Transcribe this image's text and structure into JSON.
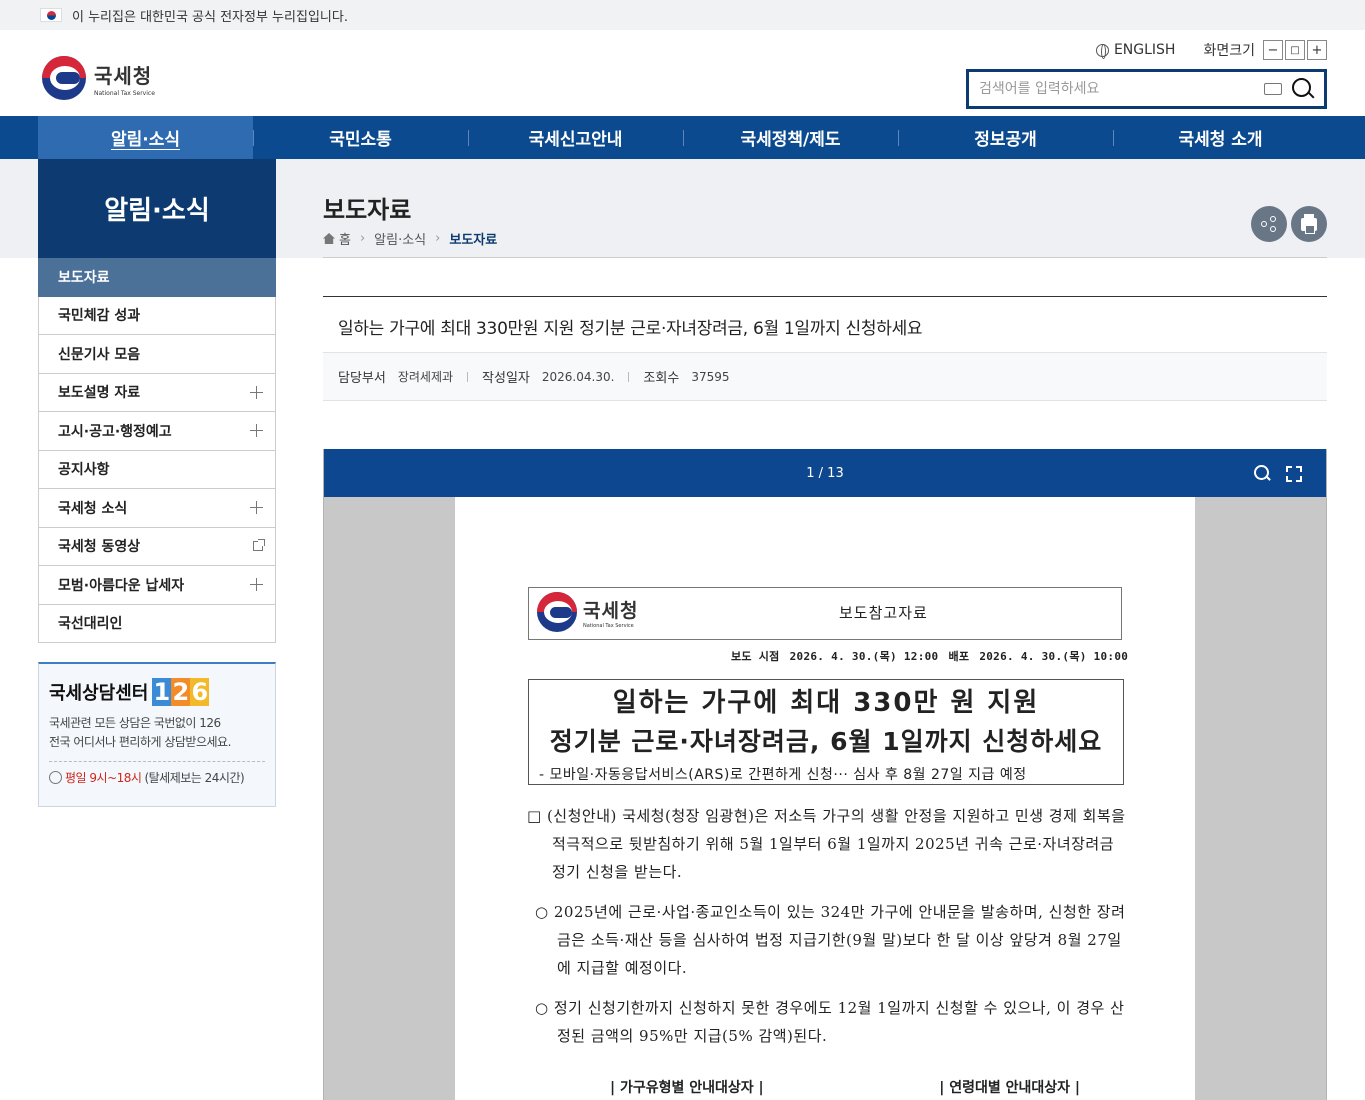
{
  "gov_banner": "이 누리집은 대한민국 공식 전자정부 누리집입니다.",
  "logo": {
    "ko": "국세청",
    "en": "National Tax Service"
  },
  "util": {
    "english": "ENGLISH",
    "font_size_label": "화면크기",
    "minus": "−",
    "reset": "□",
    "plus": "+"
  },
  "search": {
    "placeholder": "검색어를 입력하세요"
  },
  "gnb": [
    "알림·소식",
    "국민소통",
    "국세신고안내",
    "국세정책/제도",
    "정보공개",
    "국세청 소개"
  ],
  "lnb": {
    "title": "알림·소식",
    "items": [
      {
        "label": "보도자료",
        "state": "active"
      },
      {
        "label": "국민체감 성과",
        "state": "none"
      },
      {
        "label": "신문기사 모음",
        "state": "none"
      },
      {
        "label": "보도설명 자료",
        "state": "plus"
      },
      {
        "label": "고시·공고·행정예고",
        "state": "plus"
      },
      {
        "label": "공지사항",
        "state": "none"
      },
      {
        "label": "국세청 소식",
        "state": "plus"
      },
      {
        "label": "국세청 동영상",
        "state": "external"
      },
      {
        "label": "모범·아름다운 납세자",
        "state": "plus"
      },
      {
        "label": "국선대리인",
        "state": "none"
      }
    ]
  },
  "counsel": {
    "title": "국세상담센터",
    "number": [
      "1",
      "2",
      "6"
    ],
    "number_colors": [
      "#3a8ad6",
      "#f28c28",
      "#f2b928"
    ],
    "desc1": "국세관련 모든 상담은 국번없이 126",
    "desc2": "전국 어디서나 편리하게 상담받으세요.",
    "hours": "평일 9시~18시",
    "hours_note": "(탈세제보는 24시간)"
  },
  "page": {
    "title": "보도자료",
    "breadcrumb": [
      "홈",
      "알림·소식",
      "보도자료"
    ]
  },
  "post": {
    "title": "일하는 가구에 최대 330만원 지원 정기분 근로·자녀장려금, 6월 1일까지 신청하세요",
    "dept_label": "담당부서",
    "dept": "장려세제과",
    "date_label": "작성일자",
    "date": "2026.04.30.",
    "views_label": "조회수",
    "views": "37595"
  },
  "viewer": {
    "page_indicator": "1 / 13",
    "doc": {
      "logo_ko": "국세청",
      "logo_en": "National Tax Service",
      "doc_type": "보도참고자료",
      "release_label": "보도 시점",
      "release": "2026. 4. 30.(목) 12:00",
      "dist_label": "배포",
      "dist": "2026. 4. 30.(목) 10:00",
      "title1": "일하는 가구에 최대 330만 원 지원",
      "title2": "정기분 근로·자녀장려금, 6월 1일까지 신청하세요",
      "subtitle": "- 모바일·자동응답서비스(ARS)로 간편하게 신청··· 심사 후 8월 27일 지급 예정",
      "para1": "□ (신청안내) 국세청(청장 임광현)은 저소득 가구의 생활 안정을 지원하고 민생 경제 회복을 적극적으로 뒷받침하기 위해 5월 1일부터 6월 1일까지 2025년 귀속 근로·자녀장려금 정기 신청을 받는다.",
      "para2": "○ 2025년에 근로·사업·종교인소득이 있는 324만 가구에 안내문을 발송하며, 신청한 장려금은 소득·재산 등을 심사하여 법정 지급기한(9월 말)보다 한 달 이상 앞당겨 8월 27일에 지급할 예정이다.",
      "para3": "○ 정기 신청기한까지 신청하지 못한 경우에도 12월 1일까지 신청할 수 있으나, 이 경우 산정된 금액의 95%만 지급(5% 감액)된다.",
      "table1": "| 가구유형별 안내대상자 |",
      "table2": "| 연령대별 안내대상자 |"
    }
  }
}
